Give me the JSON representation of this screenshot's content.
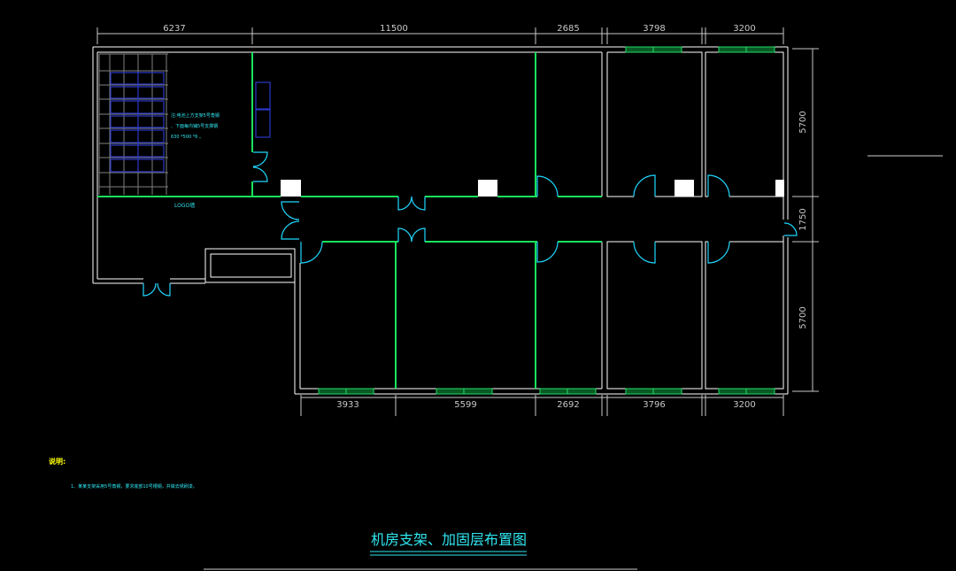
{
  "drawing": {
    "colors": {
      "background": "#000000",
      "wall": "#ffffff",
      "partition": "#19e35c",
      "door": "#1fd8ff",
      "window": "#22dd66",
      "grid": "#7f7f7f",
      "rack": "#2a38c8",
      "annot": "#2fe6f0",
      "heading": "#ffff00",
      "dim": "#c8c8c8"
    },
    "top_dimensions": [
      "6237",
      "11500",
      "2685",
      "3798",
      "3200"
    ],
    "right_dimensions": [
      "5700",
      "1750",
      "5700"
    ],
    "bottom_dimensions": [
      "3933",
      "5599",
      "2692",
      "3796",
      "3200"
    ],
    "battery_room_note": [
      "注:电池上方支架5号角钢",
      "、下面每内铺5号支撑钢",
      "630 *500 *6 。"
    ],
    "logo_wall_label": "LOGO墙",
    "notes": {
      "heading": "说明:",
      "items": [
        "1、某某支架采用5号角钢，要求底部10号槽钢，并做去锈刷漆。"
      ]
    },
    "title": "机房支架、加固层布置图"
  }
}
